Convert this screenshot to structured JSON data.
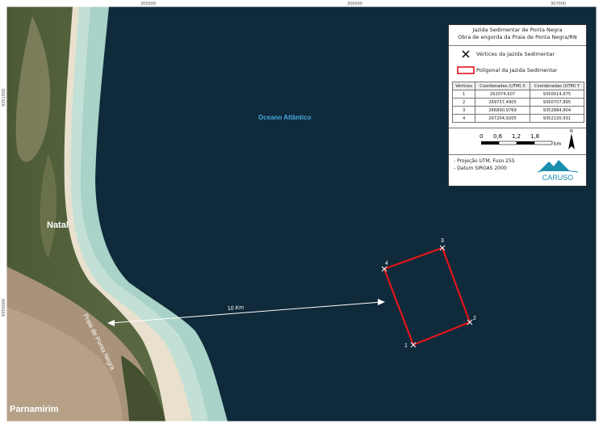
{
  "frame": {
    "top_labels": [
      "305000",
      "306000",
      "307000"
    ],
    "left_labels": [
      "9351000",
      "9350000"
    ]
  },
  "map_labels": {
    "ocean": "Oceano Atlântico",
    "city_natal": "Natal",
    "beach": "Praia de Ponta Negra",
    "city_parnamirim": "Parnamirim",
    "distance": "10 Km"
  },
  "vertex_labels": [
    "1",
    "2",
    "3",
    "4"
  ],
  "legend": {
    "title_line1": "Jazida Sedimentar de Ponta Negra",
    "title_line2": "Obra de engorda da Praia de Ponta Negra/RN",
    "items": [
      {
        "symbol": "x-marker-icon",
        "label": "Vértices da Jazida Sedimentar"
      },
      {
        "symbol": "red-rectangle-icon",
        "label": "Poligonal da Jazida Sedimentar"
      }
    ],
    "table": {
      "headers": [
        "Vértices",
        "Coordenadas (UTM) X",
        "Coordenadas (UTM) Y"
      ],
      "rows": [
        [
          "1",
          "262074,607",
          "9350014,675"
        ],
        [
          "2",
          "269737,4905",
          "9350707,895"
        ],
        [
          "3",
          "266890,9769",
          "9352884,804"
        ],
        [
          "4",
          "267204,9205",
          "9352220,931"
        ]
      ]
    },
    "scale": {
      "ticks": [
        "0",
        "0,6",
        "1,2",
        "1,8"
      ],
      "unit": "km"
    },
    "north": "N",
    "notes": [
      "- Projeção UTM, Fuso 25S",
      "- Datum SIRGAS 2000"
    ],
    "logo_text": "CARUSO"
  },
  "colors": {
    "ocean": "#0f2a3a",
    "shallow_water": "#a8cfc6",
    "sand": "#e8e0cc",
    "vegetation": "#3a4a2a",
    "urban": "#a58f78",
    "polygon": "#e0161c",
    "logo": "#1a8fb0"
  }
}
